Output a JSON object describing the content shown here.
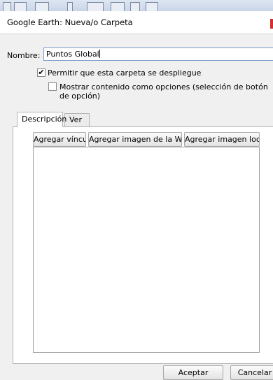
{
  "window": {
    "title": "Google Earth: Nueva/o Carpeta"
  },
  "form": {
    "name_label": "Nombre:",
    "name_value": "Puntos Global",
    "allow_expand_label": "Permitir que esta carpeta se despliegue",
    "allow_expand_checked": true,
    "show_as_options_label": "Mostrar contenido como opciones (selección de botón de opción)",
    "show_as_options_checked": false
  },
  "tabs": [
    {
      "label": "Descripción",
      "active": true
    },
    {
      "label": "Ver",
      "active": false
    }
  ],
  "description_toolbar": {
    "add_link": "Agregar vínculo",
    "add_web_image": "Agregar imagen de la Web...",
    "add_local_image": "Agregar imagen local..."
  },
  "footer": {
    "ok_label": "Aceptar",
    "cancel_label": "Cancelar"
  },
  "colors": {
    "close_button": "#d0302f",
    "input_border": "#7a9cc6"
  }
}
